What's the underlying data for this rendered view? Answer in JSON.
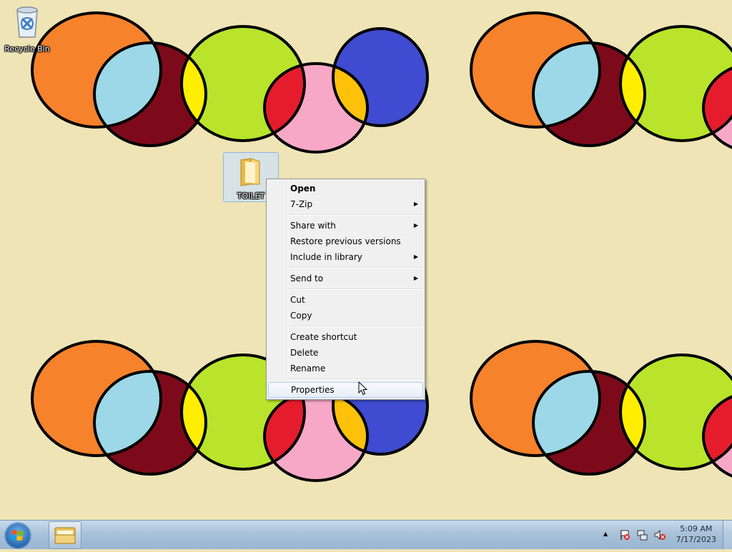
{
  "desktop": {
    "icons": [
      {
        "name": "recycle-bin",
        "label": "Recycle Bin"
      },
      {
        "name": "folder-toilet",
        "label": "TOILET"
      }
    ]
  },
  "context_menu": {
    "items": {
      "open": "Open",
      "zip": "7-Zip",
      "share_with": "Share with",
      "restore_previous_versions": "Restore previous versions",
      "include_in_library": "Include in library",
      "send_to": "Send to",
      "cut": "Cut",
      "copy": "Copy",
      "create_shortcut": "Create shortcut",
      "delete": "Delete",
      "rename": "Rename",
      "properties": "Properties"
    },
    "submenu_arrow": "▶",
    "highlighted": "Properties"
  },
  "taskbar": {
    "start_button": "windows-logo-icon",
    "pinned": [
      "file-explorer-icon"
    ],
    "tray_icons": [
      "show-hidden-icons",
      "action-center-flag-icon",
      "network-icon",
      "volume-muted-icon"
    ],
    "tray_expand_glyph": "▲",
    "clock": {
      "time": "5:09 AM",
      "date": "7/17/2023"
    }
  },
  "colors": {
    "wallpaper_bg": "#efe4b6",
    "orange": "#f6822b",
    "light_blue": "#9dd8e8",
    "dark_red": "#7d0a1a",
    "lime": "#b9e42b",
    "yellow": "#ffee00",
    "blue": "#3f4bd0",
    "red": "#e51c2c",
    "pink": "#f7a8c6",
    "amber": "#ffc20a"
  }
}
